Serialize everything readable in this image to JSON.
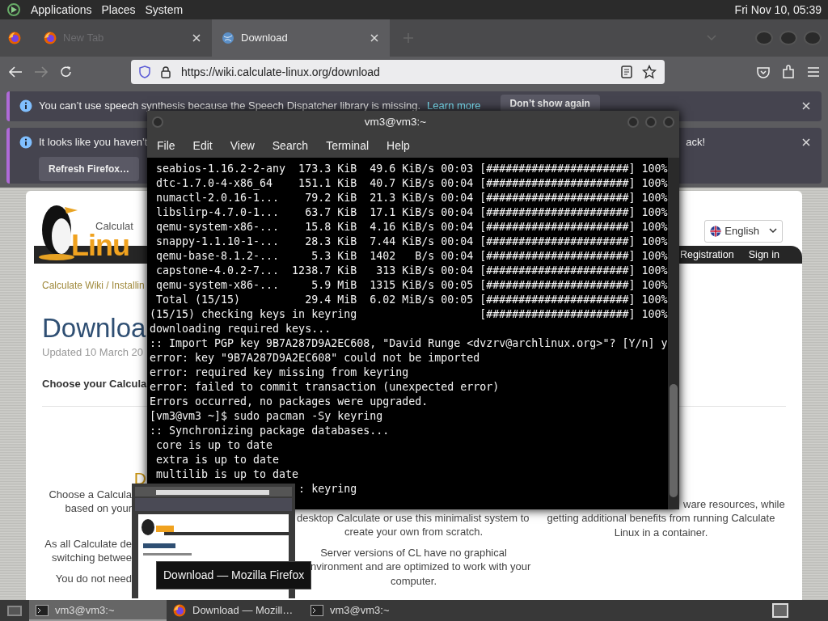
{
  "top_panel": {
    "menus": [
      "Applications",
      "Places",
      "System"
    ],
    "clock": "Fri Nov 10, 05:39"
  },
  "browser": {
    "tabs": [
      {
        "label": "New Tab",
        "selected": false
      },
      {
        "label": "Download",
        "selected": true
      }
    ],
    "url": "https://wiki.calculate-linux.org/download",
    "notifications": [
      {
        "message": "You can’t use speech synthesis because the Speech Dispatcher library is missing.",
        "link": "Learn more",
        "button": "Don’t show again"
      },
      {
        "message": "It looks like you haven’t",
        "message_tail": "ack!",
        "button": "Refresh Firefox…"
      }
    ]
  },
  "page": {
    "logo": {
      "top": "Calculat",
      "bottom": "Linu"
    },
    "language": "English",
    "nav": [
      "Registration",
      "Sign in"
    ],
    "breadcrumb": "Calculate Wiki / Installin",
    "title": "Downloa",
    "updated": "Updated 10 March 20",
    "lead": "Choose your Calcula",
    "columns": [
      {
        "heading": "D",
        "paragraphs": [
          [
            {
              "text": "Choose a Calcula",
              "kind": "cut_right"
            },
            {
              "text": "based on your",
              "kind": "cut_right"
            }
          ],
          [
            {
              "text": "As all Calculate de",
              "kind": "cut_right"
            },
            {
              "text": "switching betwee",
              "kind": "cut_right"
            }
          ],
          [
            {
              "text": "You do not need",
              "kind": "cut_right"
            }
          ]
        ]
      },
      {
        "paragraphs": [
          [
            {
              "text": "desktop Calculate or use this minimalist system to",
              "kind": "cut_left"
            },
            {
              "text": "create your own from scratch.",
              "kind": "full"
            }
          ],
          [
            {
              "text": "Server versions of CL have no graphical",
              "kind": "full"
            },
            {
              "text": "nvironment and are optimized to work with your",
              "kind": "cut_left"
            },
            {
              "text": "computer.",
              "kind": "full"
            }
          ]
        ]
      },
      {
        "paragraphs": [
          [
            {
              "text": "ware resources, while",
              "kind": "cut_left"
            },
            {
              "text": "getting additional benefits from running Calculate",
              "kind": "full"
            },
            {
              "text": "Linux in a container.",
              "kind": "full"
            }
          ]
        ]
      }
    ]
  },
  "terminal": {
    "title": "vm3@vm3:~",
    "menus": [
      "File",
      "Edit",
      "View",
      "Search",
      "Terminal",
      "Help"
    ],
    "lines": [
      " seabios-1.16.2-2-any  173.3 KiB  49.6 KiB/s 00:03 [######################] 100%",
      " dtc-1.7.0-4-x86_64    151.1 KiB  40.7 KiB/s 00:04 [######################] 100%",
      " numactl-2.0.16-1...    79.2 KiB  21.3 KiB/s 00:04 [######################] 100%",
      " libslirp-4.7.0-1...    63.7 KiB  17.1 KiB/s 00:04 [######################] 100%",
      " qemu-system-x86-...    15.8 KiB  4.16 KiB/s 00:04 [######################] 100%",
      " snappy-1.1.10-1-...    28.3 KiB  7.44 KiB/s 00:04 [######################] 100%",
      " qemu-base-8.1.2-...     5.3 KiB  1402   B/s 00:04 [######################] 100%",
      " capstone-4.0.2-7...  1238.7 KiB   313 KiB/s 00:04 [######################] 100%",
      " qemu-system-x86-...     5.9 MiB  1315 KiB/s 00:05 [######################] 100%",
      " Total (15/15)          29.4 MiB  6.02 MiB/s 00:05 [######################] 100%",
      "(15/15) checking keys in keyring                   [######################] 100%",
      "downloading required keys...",
      ":: Import PGP key 9B7A287D9A2EC608, \"David Runge <dvzrv@archlinux.org>\"? [Y/n] y",
      "error: key \"9B7A287D9A2EC608\" could not be imported",
      "error: required key missing from keyring",
      "error: failed to commit transaction (unexpected error)",
      "Errors occurred, no packages were upgraded.",
      "[vm3@vm3 ~]$ sudo pacman -Sy keyring",
      ":: Synchronizing package databases...",
      " core is up to date",
      " extra is up to date",
      " multilib is up to date",
      "                       : keyring"
    ]
  },
  "preview": {
    "tooltip": "Download — Mozilla Firefox"
  },
  "taskbar": {
    "items": [
      {
        "label": "vm3@vm3:~",
        "kind": "terminal",
        "selected": true
      },
      {
        "label": "Download — Mozill…",
        "kind": "browser",
        "selected": false
      },
      {
        "label": "vm3@vm3:~",
        "kind": "terminal",
        "selected": false
      }
    ]
  }
}
